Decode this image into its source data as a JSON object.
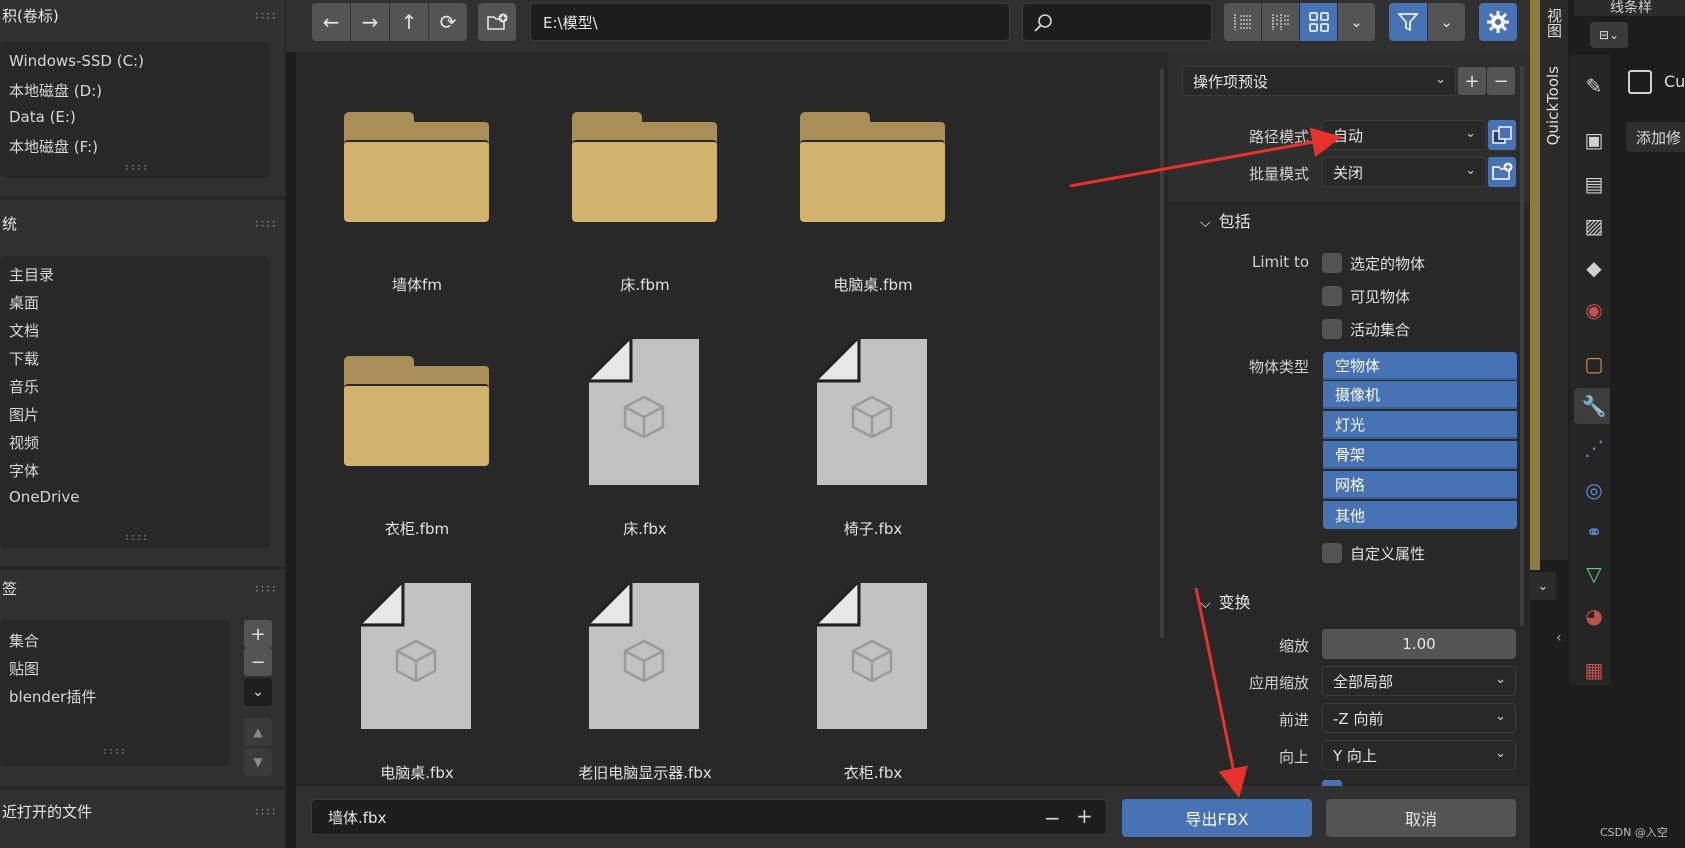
{
  "sidebar": {
    "volumes": {
      "title": "积(卷标)",
      "items": [
        "Windows-SSD (C:)",
        "本地磁盘 (D:)",
        "Data (E:)",
        "本地磁盘 (F:)"
      ]
    },
    "system": {
      "title": "统",
      "items": [
        "主目录",
        "桌面",
        "文档",
        "下载",
        "音乐",
        "图片",
        "视频",
        "字体",
        "OneDrive"
      ]
    },
    "bookmarks": {
      "title": "签",
      "items": [
        "集合",
        "贴图",
        "blender插件"
      ]
    },
    "recent": {
      "title": "近打开的文件"
    }
  },
  "toolbar": {
    "back_icon": "←",
    "forward_icon": "→",
    "parent_icon": "↑",
    "refresh_icon": "⟳",
    "new_folder_icon": "new-folder-icon",
    "path": "E:\\模型\\",
    "search_placeholder": ""
  },
  "files": [
    {
      "name": "墙体fm",
      "type": "folder"
    },
    {
      "name": "床.fbm",
      "type": "folder"
    },
    {
      "name": "电脑桌.fbm",
      "type": "folder"
    },
    {
      "name": "衣柜.fbm",
      "type": "folder"
    },
    {
      "name": "床.fbx",
      "type": "file"
    },
    {
      "name": "椅子.fbx",
      "type": "file"
    },
    {
      "name": "电脑桌.fbx",
      "type": "file"
    },
    {
      "name": "老旧电脑显示器.fbx",
      "type": "file"
    },
    {
      "name": "衣柜.fbx",
      "type": "file"
    }
  ],
  "properties": {
    "preset": "操作项预设",
    "path_mode_label": "路径模式",
    "path_mode_value": "自动",
    "batch_mode_label": "批量模式",
    "batch_mode_value": "关闭",
    "include_section": "包括",
    "limit_to_label": "Limit to",
    "limit_selected": "选定的物体",
    "limit_visible": "可见物体",
    "limit_active_collection": "活动集合",
    "object_types_label": "物体类型",
    "object_types": [
      "空物体",
      "摄像机",
      "灯光",
      "骨架",
      "网格",
      "其他"
    ],
    "custom_props": "自定义属性",
    "transform_section": "变换",
    "scale_label": "缩放",
    "scale_value": "1.00",
    "apply_scale_label": "应用缩放",
    "apply_scale_value": "全部局部",
    "forward_label": "前进",
    "forward_value": "-Z 向前",
    "up_label": "向上",
    "up_value": "Y 向上"
  },
  "bottom": {
    "filename": "墙体.fbx",
    "minus": "−",
    "plus": "+",
    "export_label": "导出FBX",
    "cancel_label": "取消"
  },
  "right_strip": {
    "tab_view": "视图",
    "tab_quicktools": "QuickTools",
    "header_text": "线条样",
    "object_label": "Cu",
    "add_modifier": "添加修",
    "watermark": "CSDN @入空"
  },
  "colors": {
    "accent_blue": "#4772b3",
    "folder_front": "#d2b36d",
    "folder_back": "#a98e58",
    "file_gray": "#c2c2c2",
    "arrow_red": "#e8312a"
  }
}
